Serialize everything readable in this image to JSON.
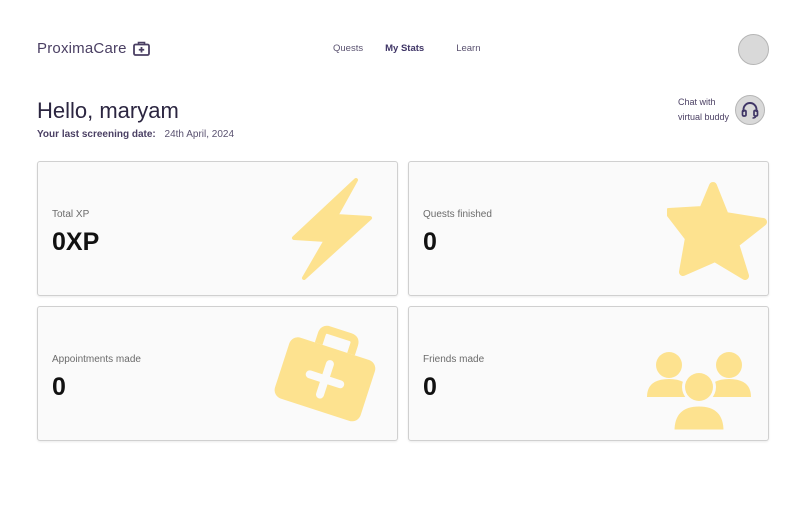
{
  "brand": {
    "name": "ProximaCare",
    "icon": "medical-kit-icon"
  },
  "nav": [
    {
      "label": "Quests",
      "active": false
    },
    {
      "label": "My Stats",
      "active": true
    },
    {
      "label": "Learn",
      "active": false
    }
  ],
  "greeting": "Hello, maryam",
  "screening": {
    "label": "Your last screening date:",
    "date": "24th April, 2024"
  },
  "buddy": {
    "line1": "Chat with",
    "line2": "virtual buddy",
    "icon": "headset-icon"
  },
  "colors": {
    "accent": "#fde28f",
    "text": "#2b2540"
  },
  "stats": [
    {
      "label": "Total XP",
      "value": "0XP",
      "icon": "lightning-icon"
    },
    {
      "label": "Quests finished",
      "value": "0",
      "icon": "star-icon"
    },
    {
      "label": "Appointments made",
      "value": "0",
      "icon": "medical-case-icon"
    },
    {
      "label": "Friends made",
      "value": "0",
      "icon": "group-icon"
    }
  ]
}
